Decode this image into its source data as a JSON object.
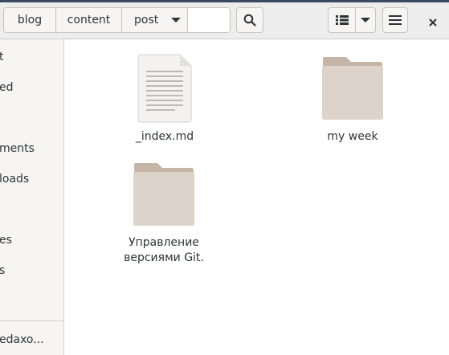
{
  "breadcrumbs": [
    "blog",
    "content",
    "post"
  ],
  "sidebar": {
    "items": [
      "t",
      "ed",
      "ments",
      "loads",
      "es",
      "s"
    ],
    "bottom": "edaxo..."
  },
  "files": [
    {
      "name": "_index.md",
      "icon": "text-file-icon"
    },
    {
      "name": "my week",
      "icon": "folder-icon"
    },
    {
      "name": "Управление версиями Git.",
      "icon": "folder-icon"
    }
  ],
  "colors": {
    "folder_tab": "#c5b5a6",
    "folder_body": "#ddd3ca",
    "headerbar": "#ededed"
  }
}
